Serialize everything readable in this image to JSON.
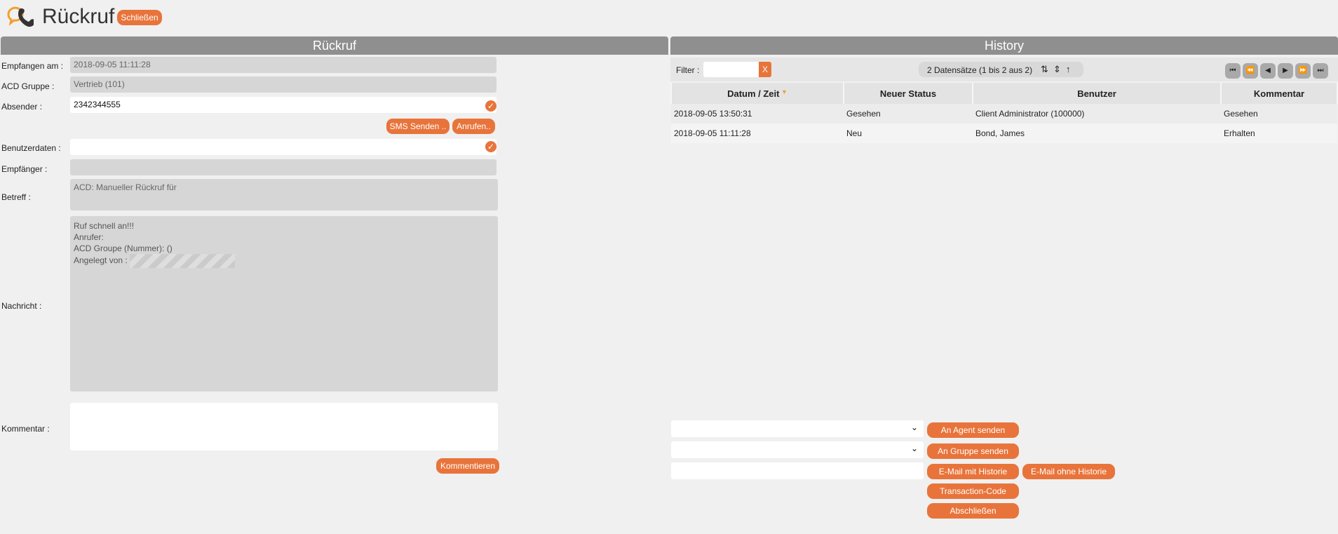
{
  "header": {
    "title": "Rückruf",
    "close_label": "Schließen"
  },
  "left_panel": {
    "title": "Rückruf",
    "fields": {
      "empfangen_label": "Empfangen am :",
      "empfangen_value": "2018-09-05 11:11:28",
      "acd_label": "ACD Gruppe :",
      "acd_value": "Vertrieb (101)",
      "absender_label": "Absender :",
      "absender_value": "2342344555",
      "benutzerdaten_label": "Benutzerdaten :",
      "benutzerdaten_value": "",
      "empfaenger_label": "Empfänger :",
      "empfaenger_value": "",
      "betreff_label": "Betreff :",
      "betreff_value": "ACD: Manueller Rückruf für",
      "nachricht_label": "Nachricht :",
      "nachricht_lines": [
        "Ruf schnell an!!!",
        "Anrufer:",
        "ACD Groupe (Nummer):  ()",
        "Angelegt von :"
      ],
      "kommentar_label": "Kommentar :",
      "kommentar_value": ""
    },
    "buttons": {
      "sms": "SMS Senden ..",
      "call": "Anrufen..",
      "comment": "Kommentieren"
    }
  },
  "right_panel": {
    "title": "History",
    "filter_label": "Filter :",
    "filter_value": "",
    "filter_clear": "X",
    "record_info": "2 Datensätze (1 bis 2 aus 2)",
    "columns": [
      "Datum / Zeit",
      "Neuer Status",
      "Benutzer",
      "Kommentar"
    ],
    "rows": [
      {
        "datum": "2018-09-05 13:50:31",
        "status": "Gesehen",
        "benutzer": "Client Administrator (100000)",
        "kommentar": "Gesehen"
      },
      {
        "datum": "2018-09-05 11:11:28",
        "status": "Neu",
        "benutzer": "Bond, James",
        "kommentar": "Erhalten"
      }
    ],
    "nav_icons": [
      "first-page-icon",
      "fast-back-icon",
      "prev-page-icon",
      "next-page-icon",
      "fast-forward-icon",
      "last-page-icon"
    ],
    "agent_select_value": "",
    "group_select_value": "",
    "email_input_value": "",
    "buttons": {
      "agent": "An Agent senden",
      "group": "An Gruppe senden",
      "email_with": "E-Mail mit Historie",
      "email_without": "E-Mail ohne Historie",
      "transaction": "Transaction-Code",
      "finish": "Abschließen"
    }
  },
  "colors": {
    "accent": "#e8743b",
    "panel_header": "#8f8f8f",
    "readonly_bg": "#d6d6d6"
  }
}
